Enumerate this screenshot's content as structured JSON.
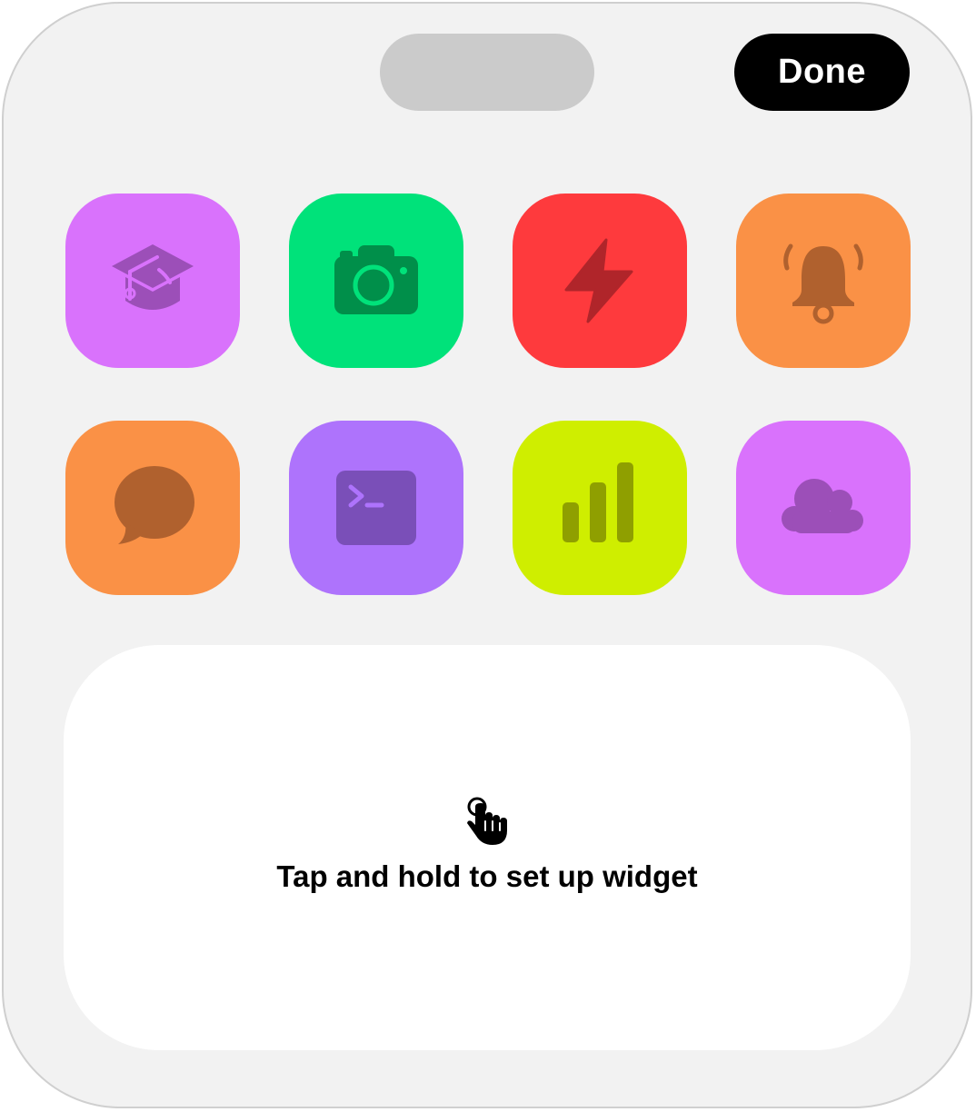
{
  "header": {
    "done_label": "Done"
  },
  "apps": [
    {
      "icon": "graduation-cap-icon",
      "bg": "#d972fc",
      "fg": "#9c4fb8"
    },
    {
      "icon": "camera-icon",
      "bg": "#00e27a",
      "fg": "#008f4a"
    },
    {
      "icon": "bolt-icon",
      "bg": "#fe3a3d",
      "fg": "#b0252a"
    },
    {
      "icon": "alarm-bell-icon",
      "bg": "#fa9146",
      "fg": "#b0612e"
    },
    {
      "icon": "chat-bubble-icon",
      "bg": "#fa9146",
      "fg": "#b0612e"
    },
    {
      "icon": "terminal-icon",
      "bg": "#ae73fc",
      "fg": "#7a4fb8"
    },
    {
      "icon": "signal-bars-icon",
      "bg": "#cfee00",
      "fg": "#8f9f00"
    },
    {
      "icon": "cloud-icon",
      "bg": "#d972fc",
      "fg": "#9c4fb8"
    }
  ],
  "widget": {
    "icon": "tap-hand-icon",
    "message": "Tap and hold to set up widget"
  }
}
